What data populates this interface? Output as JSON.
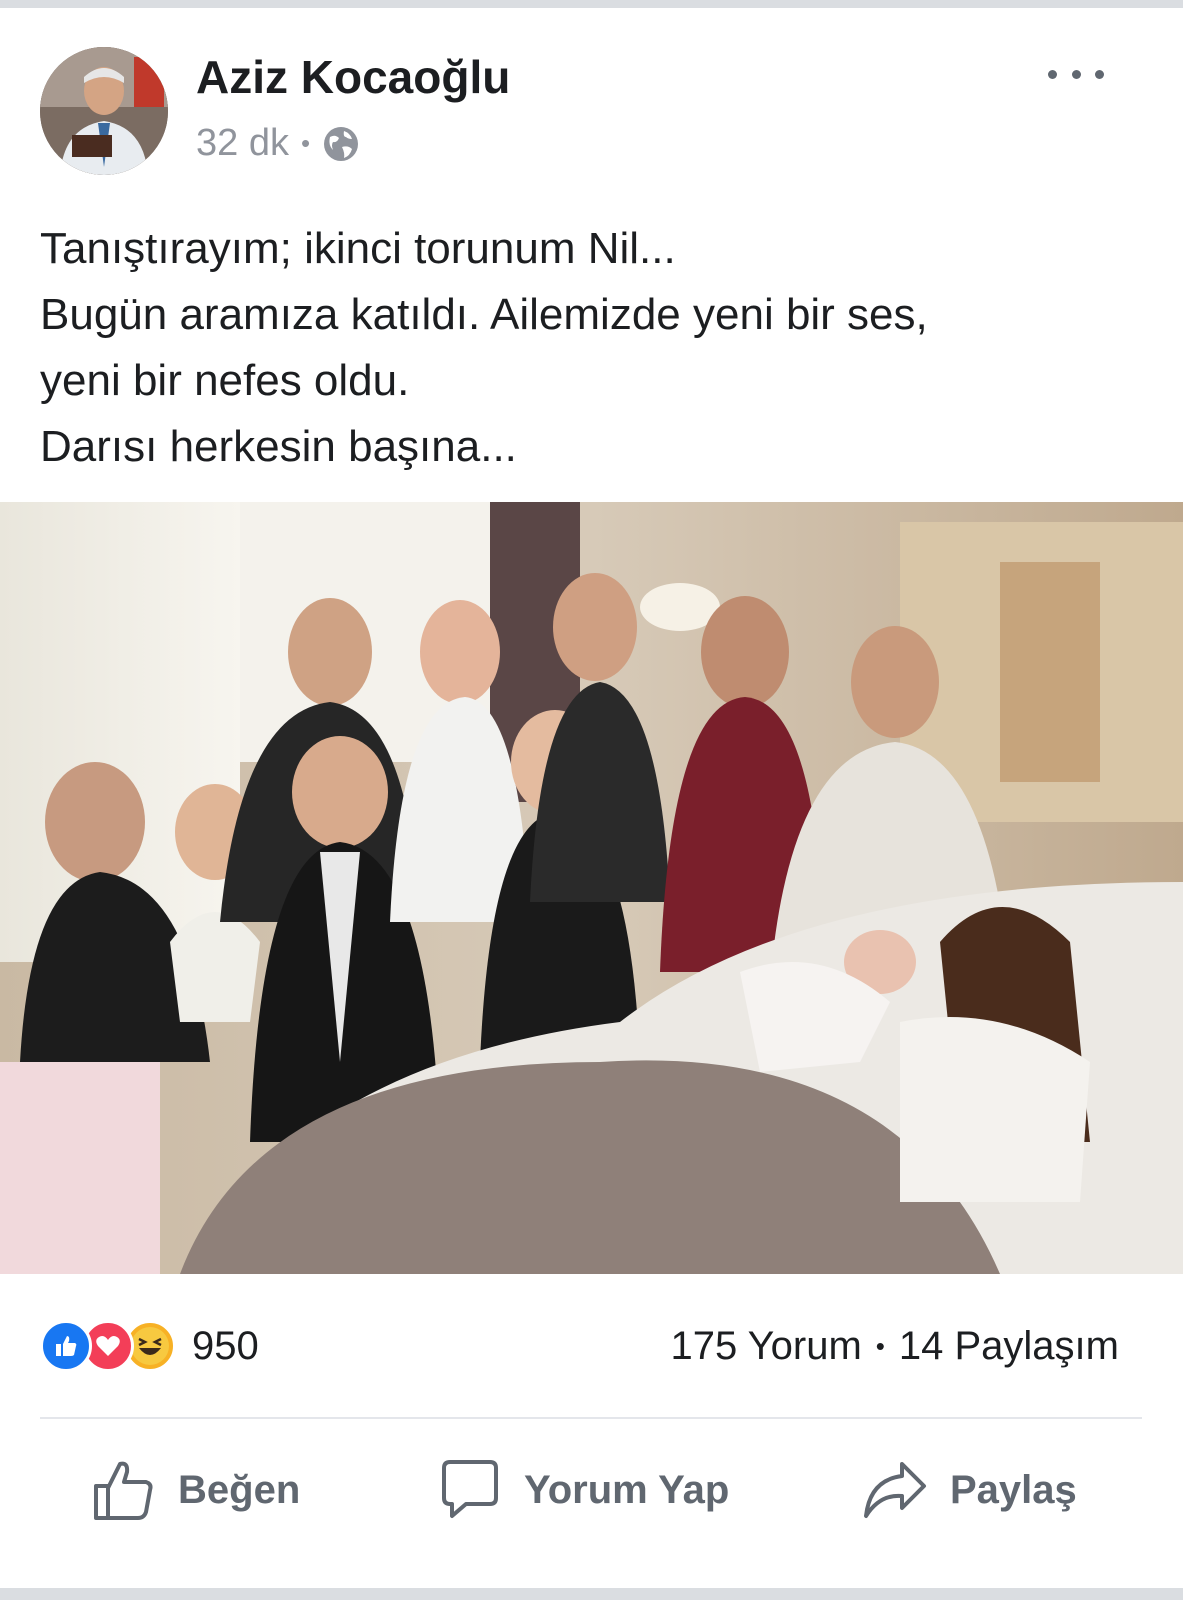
{
  "post": {
    "author": "Aziz Kocaoğlu",
    "time": "32 dk",
    "meta_separator": "•",
    "privacy_icon": "globe-icon",
    "more_icon": "more-dots-icon",
    "text_lines": [
      "Tanıştırayım; ikinci torunum Nil...",
      "Bugün aramıza katıldı. Ailemizde yeni bir ses,",
      "yeni bir nefes oldu.",
      "Darısı herkesin başına..."
    ]
  },
  "engagement": {
    "reaction_icons": [
      "like-icon",
      "love-icon",
      "haha-icon"
    ],
    "reaction_count": "950",
    "comments": "175 Yorum",
    "separator": "•",
    "shares": "14 Paylaşım"
  },
  "actions": {
    "like_label": "Beğen",
    "comment_label": "Yorum Yap",
    "share_label": "Paylaş"
  },
  "colors": {
    "link_blue": "#1877f2",
    "love_red": "#f33e58",
    "haha_yellow": "#f7b125",
    "secondary_text": "#90949c",
    "action_gray": "#606770"
  }
}
